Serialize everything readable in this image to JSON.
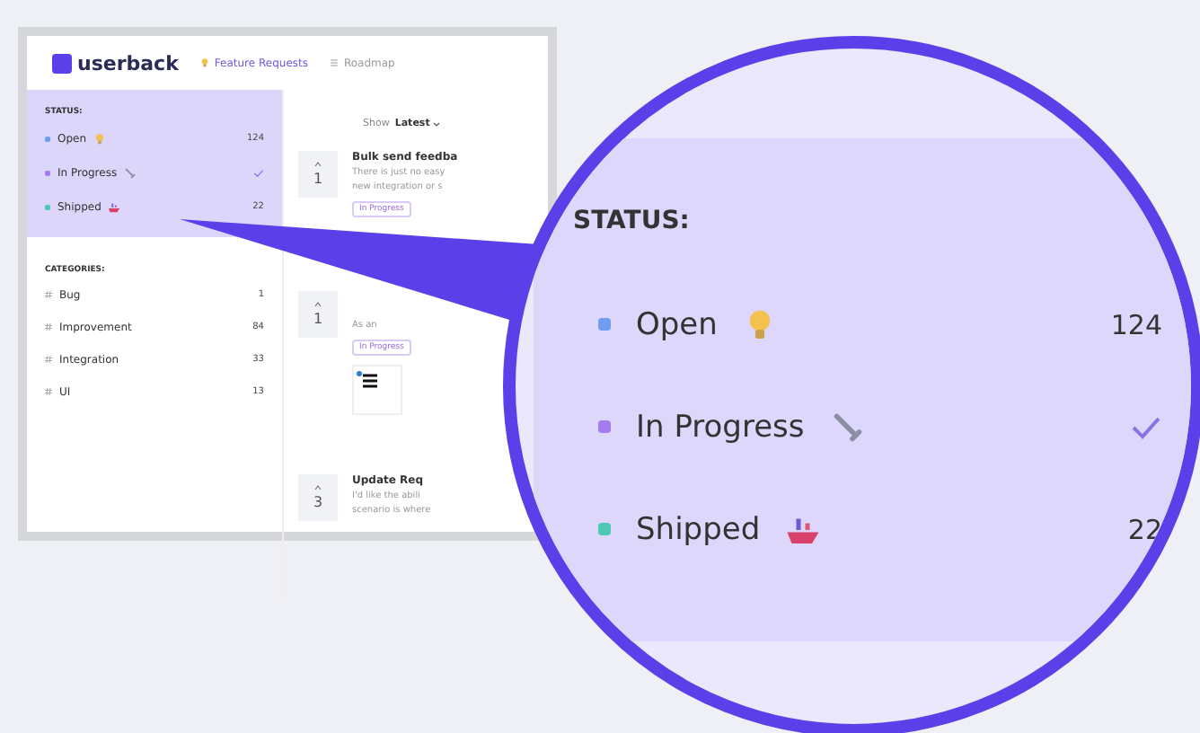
{
  "header": {
    "logo": "userback",
    "nav": [
      {
        "label": "Feature Requests",
        "kind": "bulb",
        "selected": true
      },
      {
        "label": "Roadmap",
        "kind": "list",
        "selected": false
      }
    ]
  },
  "sidebar": {
    "status_title": "STATUS:",
    "statuses": [
      {
        "label": "Open",
        "kind": "bulb",
        "color": "#6f9cf0",
        "count": "124",
        "selected": false
      },
      {
        "label": "In Progress",
        "kind": "wrench",
        "color": "#a57cf0",
        "selected": true
      },
      {
        "label": "Shipped",
        "kind": "ship",
        "color": "#4fc7b5",
        "count": "22",
        "selected": false
      }
    ],
    "categories_title": "CATEGORIES:",
    "categories": [
      {
        "label": "Bug",
        "count": "1"
      },
      {
        "label": "Improvement",
        "count": "84"
      },
      {
        "label": "Integration",
        "count": "33"
      },
      {
        "label": "UI",
        "count": "13"
      }
    ]
  },
  "main": {
    "sort_label": "Show",
    "sort_value": "Latest",
    "posts": [
      {
        "votes": "1",
        "title": "Bulk send feedba",
        "excerpt": [
          "There is just no easy",
          "new integration or s"
        ],
        "tag": "In Progress",
        "image": false
      },
      {
        "votes": "1",
        "excerpt": [
          "As an"
        ],
        "tag": "In Progress",
        "image": true
      },
      {
        "votes": "3",
        "title": "Update Req",
        "excerpt": [
          "I'd like the abili",
          "scenario is where"
        ],
        "image": false
      }
    ]
  },
  "magnifier": {
    "title": "STATUS:",
    "statuses": [
      {
        "label": "Open",
        "kind": "bulb",
        "color": "#6f9cf0",
        "count": "124",
        "selected": false
      },
      {
        "label": "In Progress",
        "kind": "wrench",
        "color": "#a57cf0",
        "selected": true
      },
      {
        "label": "Shipped",
        "kind": "ship",
        "color": "#4fc7b5",
        "count": "22",
        "selected": false
      }
    ]
  }
}
